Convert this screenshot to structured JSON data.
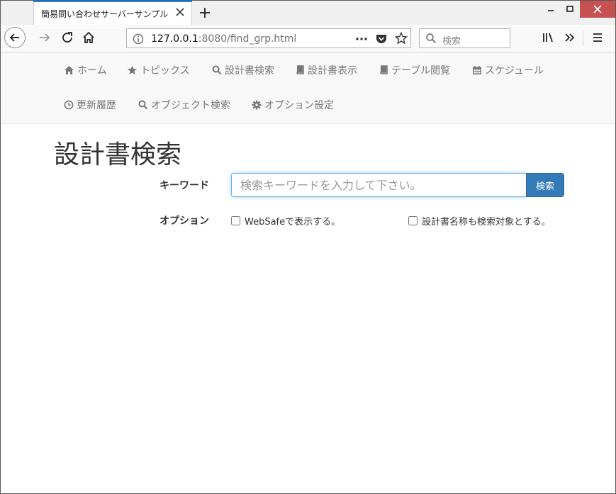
{
  "browser": {
    "tab_title": "簡易問い合わせサーバーサンプル",
    "url_host": "127.0.0.1",
    "url_rest": ":8080/find_grp.html",
    "search_placeholder": "検索"
  },
  "nav": {
    "items": [
      {
        "label": "ホーム",
        "icon": "home-icon"
      },
      {
        "label": "トピックス",
        "icon": "star-icon"
      },
      {
        "label": "設計書検索",
        "icon": "search-icon"
      },
      {
        "label": "設計書表示",
        "icon": "book-icon"
      },
      {
        "label": "テーブル閲覧",
        "icon": "book-icon"
      },
      {
        "label": "スケジュール",
        "icon": "calendar-icon"
      },
      {
        "label": "更新履歴",
        "icon": "clock-icon"
      },
      {
        "label": "オブジェクト検索",
        "icon": "search-icon"
      },
      {
        "label": "オプション設定",
        "icon": "gear-icon"
      }
    ]
  },
  "main": {
    "title": "設計書検索",
    "keyword_label": "キーワード",
    "keyword_placeholder": "検索キーワードを入力して下さい。",
    "search_button": "検索",
    "option_label": "オプション",
    "option_websafe": "WebSafeで表示する。",
    "option_include_name": "設計書名称も検索対象とする。"
  },
  "colors": {
    "primary": "#337ab7",
    "nav_text": "#777777",
    "window_close": "#c75050",
    "tab_accent": "#0a84ff"
  }
}
